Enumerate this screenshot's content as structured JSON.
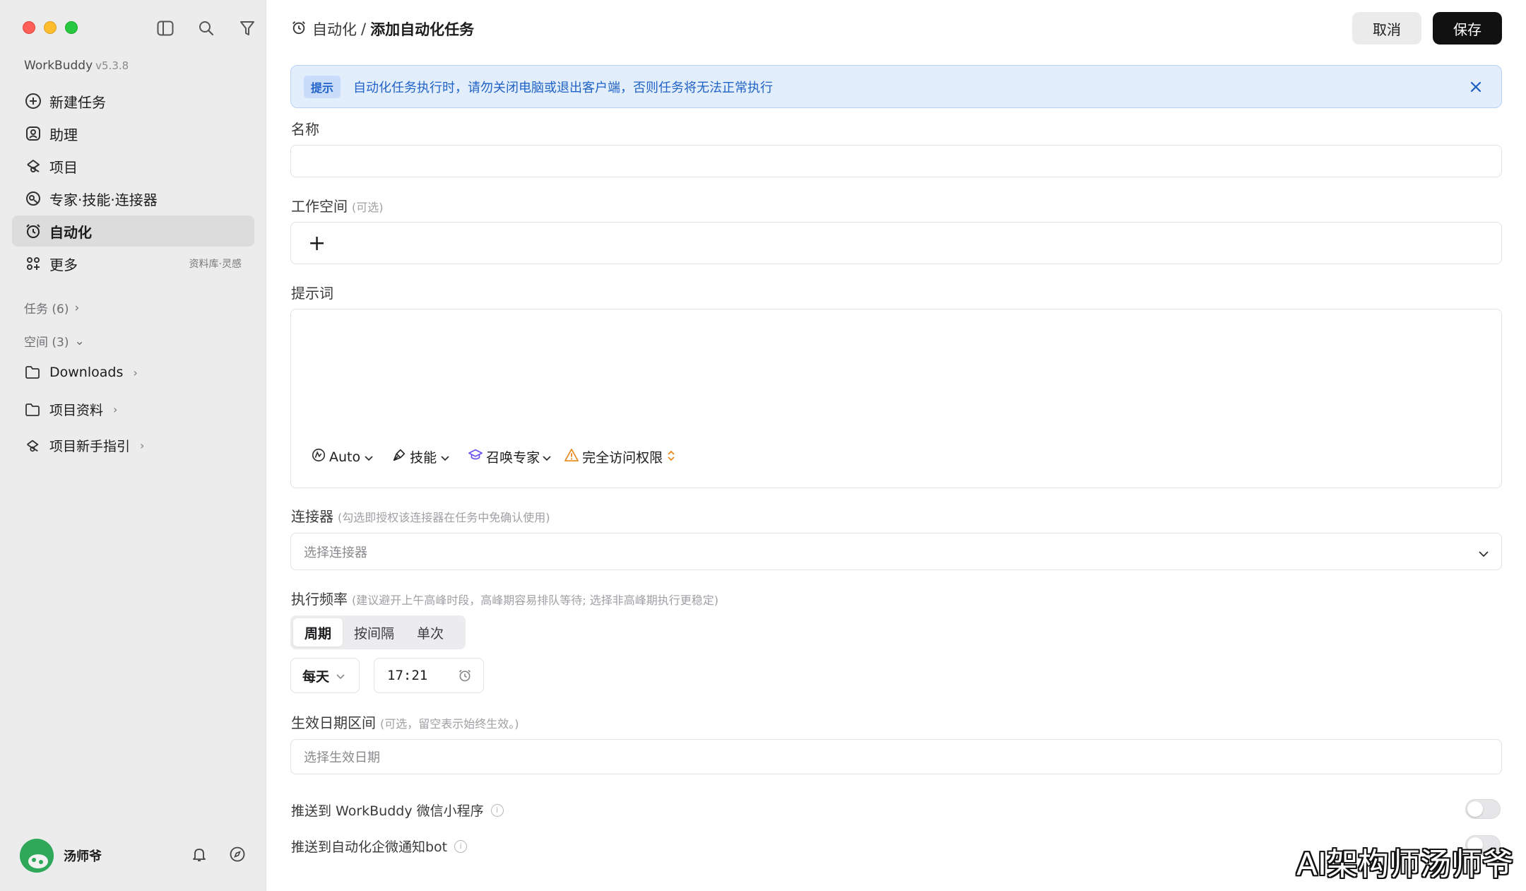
{
  "app": {
    "name": "WorkBuddy",
    "version": "v5.3.8"
  },
  "sidebar": {
    "nav": [
      {
        "label": "新建任务",
        "icon": "plus-circle-icon"
      },
      {
        "label": "助理",
        "icon": "assistant-icon"
      },
      {
        "label": "项目",
        "icon": "project-icon"
      },
      {
        "label": "专家·技能·连接器",
        "icon": "expert-icon"
      },
      {
        "label": "自动化",
        "icon": "alarm-clock-icon",
        "active": true
      },
      {
        "label": "更多",
        "icon": "grid-icon",
        "sub": "资料库·灵感"
      }
    ],
    "tasks_group": "任务 (6)",
    "spaces_group": "空间 (3)",
    "folders": [
      {
        "label": "Downloads",
        "icon": "folder-icon"
      },
      {
        "label": "项目资料",
        "icon": "folder-icon"
      },
      {
        "label": "项目新手指引",
        "icon": "project-icon"
      }
    ],
    "user": {
      "name": "汤师爷"
    }
  },
  "header": {
    "breadcrumb_parent": "自动化",
    "breadcrumb_sep": "/",
    "breadcrumb_current": "添加自动化任务",
    "cancel_label": "取消",
    "save_label": "保存"
  },
  "notice": {
    "tag": "提示",
    "message": "自动化任务执行时，请勿关闭电脑或退出客户端，否则任务将无法正常执行"
  },
  "form": {
    "name_label": "名称",
    "name_value": "",
    "workspace_label": "工作空间",
    "workspace_hint": "(可选)",
    "workspace_add": "+",
    "prompt_label": "提示词",
    "prompt_value": "",
    "prompt_tools": {
      "model": "Auto",
      "skills": "技能",
      "expert": "召唤专家",
      "access": "完全访问权限"
    },
    "connector_label": "连接器",
    "connector_hint": "(勾选即授权该连接器在任务中免确认使用)",
    "connector_placeholder": "选择连接器",
    "frequency_label": "执行频率",
    "frequency_hint": "(建议避开上午高峰时段，高峰期容易排队等待; 选择非高峰期执行更稳定)",
    "frequency_options": [
      "周期",
      "按间隔",
      "单次"
    ],
    "frequency_selected": "周期",
    "repeat_value": "每天",
    "time_value": "17:21",
    "date_range_label": "生效日期区间",
    "date_range_hint": "(可选，留空表示始终生效。)",
    "date_range_placeholder": "选择生效日期",
    "push_wechat_label": "推送到 WorkBuddy 微信小程序",
    "push_wecom_label": "推送到自动化企微通知bot",
    "push_wechat_on": false,
    "push_wecom_on": false
  },
  "watermark": "AI架构师汤师爷",
  "colors": {
    "accent": "#111111",
    "notice_bg": "#e3eefc",
    "notice_text": "#2163c6",
    "warning": "#e8891c"
  }
}
